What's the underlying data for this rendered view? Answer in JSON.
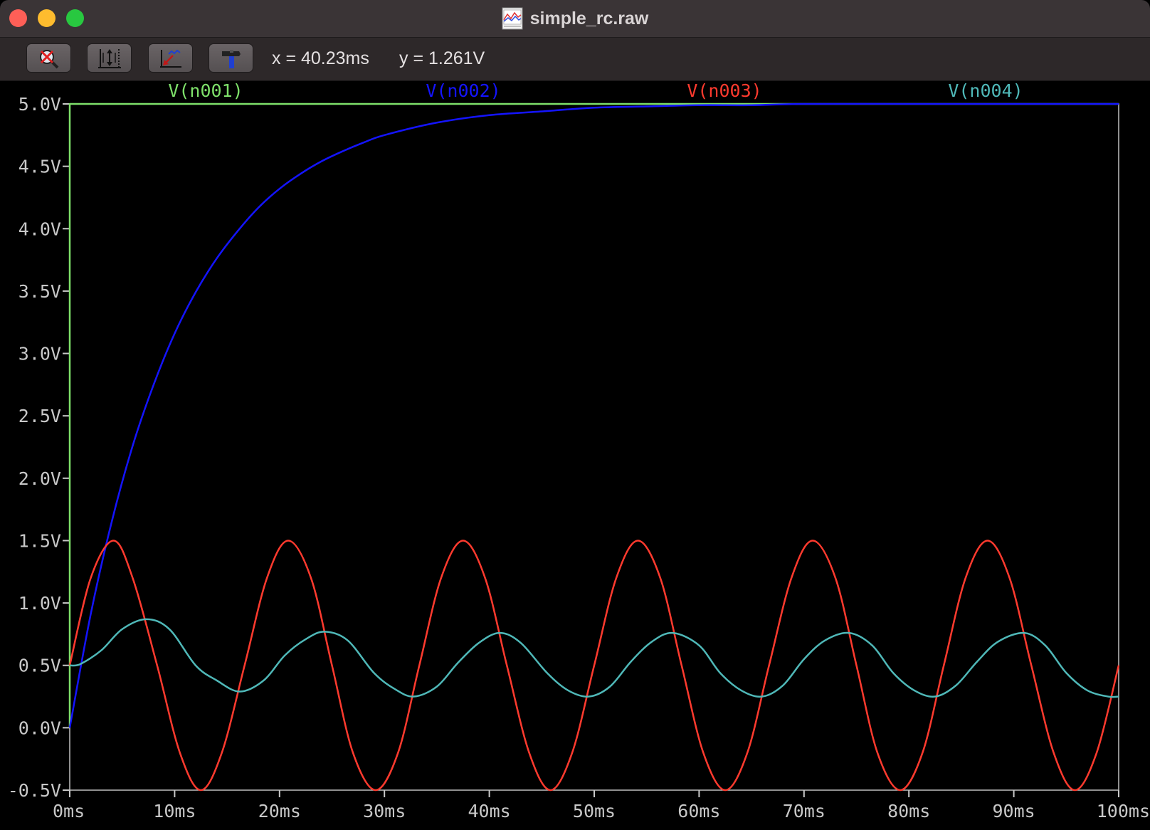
{
  "window": {
    "title": "simple_rc.raw",
    "icons": [
      "close-button",
      "minimize-button",
      "zoom-button",
      "waveform-document-icon"
    ]
  },
  "toolbar": {
    "buttons": [
      {
        "name": "zoom-cancel",
        "icon": "magnifier-cross-icon"
      },
      {
        "name": "autorange-y",
        "icon": "vertical-range-icon"
      },
      {
        "name": "zoom-back",
        "icon": "zoom-back-icon"
      },
      {
        "name": "probe",
        "icon": "hammer-icon"
      }
    ],
    "cursor_x": "x = 40.23ms",
    "cursor_y": "y = 1.261V"
  },
  "colors": {
    "n001": "#7ee06a",
    "n002": "#1414ff",
    "n003": "#ff3a2e",
    "n004": "#4fb8b8",
    "axis": "#c8c8c8",
    "frame": "#c0c0c0"
  },
  "chart_data": {
    "type": "line",
    "xlabel": "",
    "ylabel": "",
    "xlim": [
      0,
      100
    ],
    "ylim": [
      -0.5,
      5.0
    ],
    "x_unit": "ms",
    "y_unit": "V",
    "x_ticks": [
      "0ms",
      "10ms",
      "20ms",
      "30ms",
      "40ms",
      "50ms",
      "60ms",
      "70ms",
      "80ms",
      "90ms",
      "100ms"
    ],
    "x_tick_values": [
      0,
      10,
      20,
      30,
      40,
      50,
      60,
      70,
      80,
      90,
      100
    ],
    "y_ticks": [
      "5.0V",
      "4.5V",
      "4.0V",
      "3.5V",
      "3.0V",
      "2.5V",
      "2.0V",
      "1.5V",
      "1.0V",
      "0.5V",
      "0.0V",
      "-0.5V"
    ],
    "y_tick_values": [
      5.0,
      4.5,
      4.0,
      3.5,
      3.0,
      2.5,
      2.0,
      1.5,
      1.0,
      0.5,
      0.0,
      -0.5
    ],
    "grid": false,
    "legend_position": "top",
    "series": [
      {
        "name": "V(n001)",
        "color": "#7ee06a",
        "x": [
          0,
          0,
          0.001,
          100
        ],
        "y": [
          0,
          5.0,
          5.0,
          5.0
        ]
      },
      {
        "name": "V(n002)",
        "color": "#1414ff",
        "x": [
          0,
          2,
          4,
          6,
          8,
          10,
          12,
          14,
          16,
          18,
          20,
          22,
          24,
          26,
          28,
          30,
          35,
          40,
          45,
          50,
          55,
          60,
          65,
          70,
          80,
          90,
          100
        ],
        "y": [
          0.0,
          0.91,
          1.65,
          2.26,
          2.75,
          3.16,
          3.49,
          3.76,
          3.98,
          4.17,
          4.32,
          4.44,
          4.54,
          4.62,
          4.69,
          4.75,
          4.85,
          4.91,
          4.94,
          4.97,
          4.98,
          4.99,
          4.99,
          5.0,
          5.0,
          5.0,
          5.0
        ]
      },
      {
        "name": "V(n003)",
        "color": "#ff3a2e",
        "x": [
          0,
          2,
          4.17,
          6,
          8.33,
          10.5,
          12.5,
          14.5,
          16.67,
          18.8,
          20.83,
          23,
          25,
          27,
          29.17,
          31.3,
          33.33,
          35.4,
          37.5,
          39.6,
          41.67,
          43.8,
          45.83,
          47.9,
          50,
          52.1,
          54.17,
          56.3,
          58.33,
          60.4,
          62.5,
          64.6,
          66.67,
          68.8,
          70.83,
          73,
          75,
          77,
          79.17,
          81.3,
          83.33,
          85.4,
          87.5,
          89.6,
          91.67,
          93.8,
          95.83,
          97.9,
          100
        ],
        "y": [
          0.5,
          1.2,
          1.5,
          1.2,
          0.5,
          -0.2,
          -0.5,
          -0.2,
          0.5,
          1.2,
          1.5,
          1.2,
          0.5,
          -0.2,
          -0.5,
          -0.2,
          0.5,
          1.2,
          1.5,
          1.2,
          0.5,
          -0.2,
          -0.5,
          -0.2,
          0.5,
          1.2,
          1.5,
          1.2,
          0.5,
          -0.2,
          -0.5,
          -0.2,
          0.5,
          1.2,
          1.5,
          1.2,
          0.5,
          -0.2,
          -0.5,
          -0.2,
          0.5,
          1.2,
          1.5,
          1.2,
          0.5,
          -0.2,
          -0.5,
          -0.2,
          0.5
        ]
      },
      {
        "name": "V(n004)",
        "color": "#4fb8b8",
        "x": [
          0,
          1,
          3,
          5,
          7.3,
          9.5,
          12,
          14,
          16.2,
          18.5,
          20.5,
          22.5,
          24.3,
          26.5,
          29,
          31,
          32.8,
          35,
          37,
          39,
          41,
          43,
          45.5,
          47.5,
          49.5,
          51.5,
          53.5,
          55.5,
          57.5,
          60,
          62,
          64,
          66,
          68,
          70,
          72,
          74.3,
          76.5,
          78.5,
          80.5,
          82.5,
          84.5,
          86.5,
          88.5,
          91,
          93,
          95,
          97,
          99,
          100
        ],
        "y": [
          0.5,
          0.51,
          0.62,
          0.79,
          0.87,
          0.79,
          0.5,
          0.38,
          0.29,
          0.38,
          0.58,
          0.71,
          0.77,
          0.7,
          0.44,
          0.31,
          0.25,
          0.33,
          0.52,
          0.68,
          0.76,
          0.68,
          0.44,
          0.3,
          0.25,
          0.33,
          0.53,
          0.69,
          0.76,
          0.66,
          0.44,
          0.3,
          0.25,
          0.34,
          0.55,
          0.7,
          0.76,
          0.66,
          0.44,
          0.3,
          0.25,
          0.34,
          0.53,
          0.69,
          0.76,
          0.66,
          0.44,
          0.3,
          0.25,
          0.25
        ]
      }
    ]
  }
}
